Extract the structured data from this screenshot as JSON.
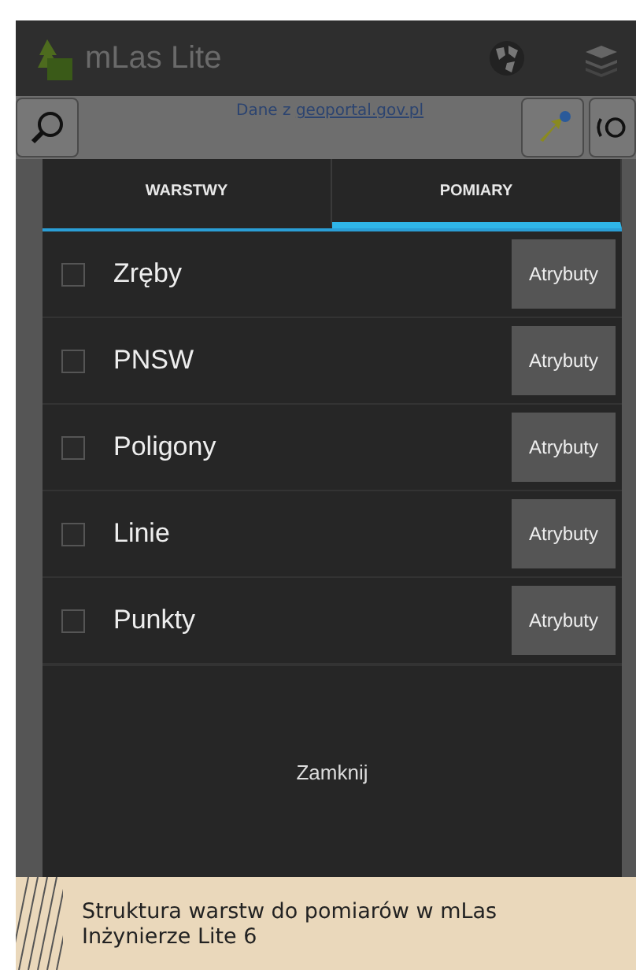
{
  "app_bar": {
    "title": "mLas Lite"
  },
  "map_bar": {
    "attribution_prefix": "Dane z",
    "attribution_link": "geoportal.gov.pl"
  },
  "dialog": {
    "tabs": [
      {
        "label": "WARSTWY",
        "selected": false
      },
      {
        "label": "POMIARY",
        "selected": true
      }
    ],
    "layers": [
      {
        "name": "Zręby",
        "checked": false,
        "button": "Atrybuty"
      },
      {
        "name": "PNSW",
        "checked": false,
        "button": "Atrybuty"
      },
      {
        "name": "Poligony",
        "checked": false,
        "button": "Atrybuty"
      },
      {
        "name": "Linie",
        "checked": false,
        "button": "Atrybuty"
      },
      {
        "name": "Punkty",
        "checked": false,
        "button": "Atrybuty"
      }
    ],
    "close_button": "Zamknij"
  },
  "caption": "Struktura warstw do pomiarów w mLas Inżynierze Lite 6"
}
